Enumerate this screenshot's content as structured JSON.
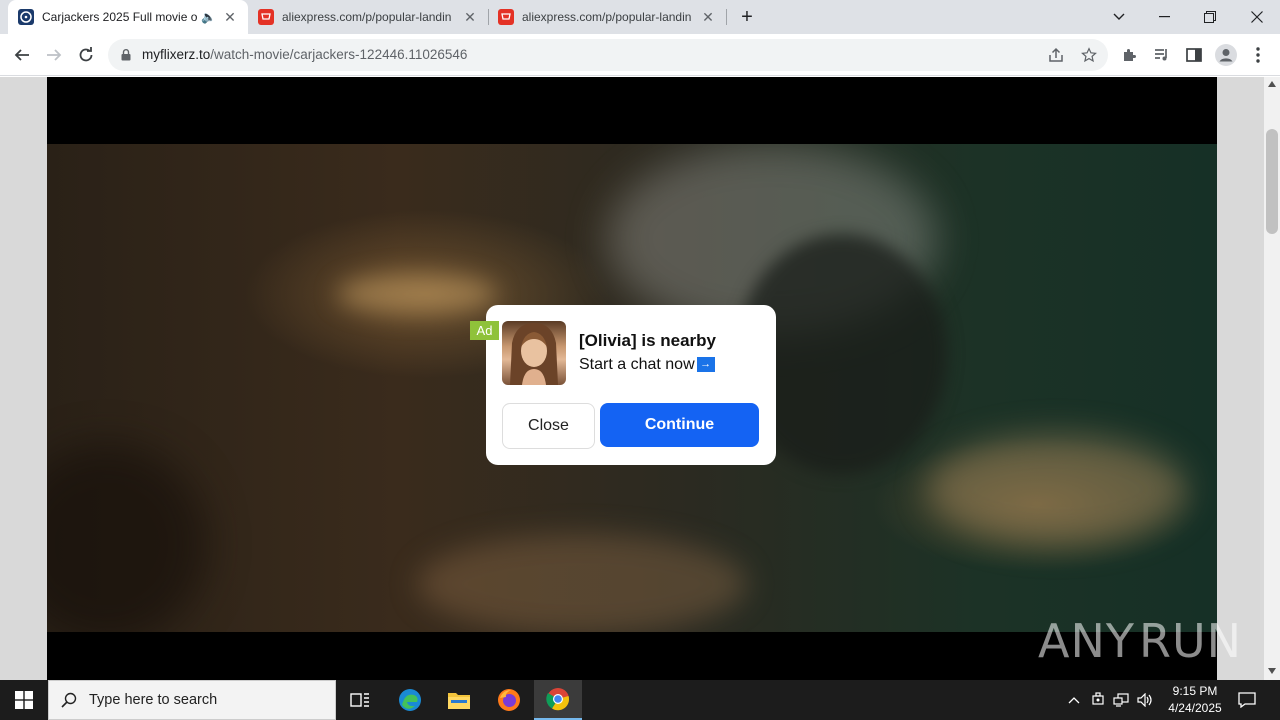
{
  "browser": {
    "tabs": [
      {
        "title": "Carjackers 2025 Full movie o",
        "active": true,
        "audio": true
      },
      {
        "title": "aliexpress.com/p/popular-landin",
        "active": false
      },
      {
        "title": "aliexpress.com/p/popular-landin",
        "active": false
      }
    ],
    "new_tab_symbol": "+",
    "url_domain": "myflixerz.to",
    "url_path": "/watch-movie/carjackers-122446.11026546"
  },
  "ad": {
    "badge": "Ad",
    "headline": "[Olivia] is nearby",
    "subline": "Start a chat now",
    "arrow": "→",
    "close_label": "Close",
    "continue_label": "Continue"
  },
  "watermark": {
    "left": "ANY",
    "right": "RUN"
  },
  "taskbar": {
    "search_placeholder": "Type here to search",
    "time": "9:15 PM",
    "date": "4/24/2025"
  },
  "colors": {
    "accent": "#1463f3",
    "ad_badge": "#8fc23a",
    "taskbar": "#1c1c1c"
  }
}
